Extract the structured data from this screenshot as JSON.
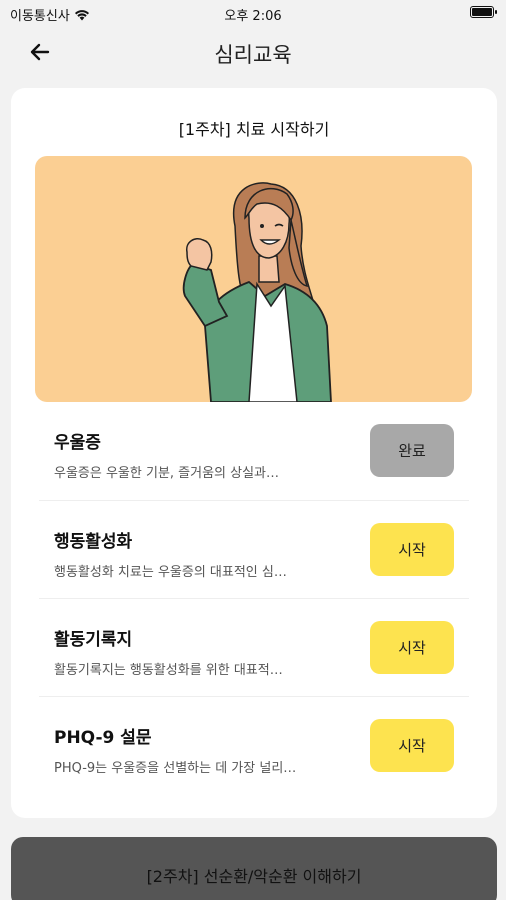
{
  "status_bar": {
    "carrier": "이동통신사",
    "time": "오후 2:06"
  },
  "nav": {
    "title": "심리교육"
  },
  "week": {
    "title": "[1주차] 치료 시작하기"
  },
  "lessons": [
    {
      "title": "우울증",
      "description": "우울증은 우울한 기분, 즐거움의 상실과…",
      "button": "완료",
      "status": "done"
    },
    {
      "title": "행동활성화",
      "description": "행동활성화 치료는 우울증의 대표적인 심…",
      "button": "시작",
      "status": "start"
    },
    {
      "title": "활동기록지",
      "description": "활동기록지는 행동활성화를 위한 대표적…",
      "button": "시작",
      "status": "start"
    },
    {
      "title": "PHQ-9 설문",
      "description": "PHQ-9는 우울증을 선별하는 데 가장 널리…",
      "button": "시작",
      "status": "start"
    }
  ],
  "next_week": {
    "title": "[2주차] 선순환/악순환 이해하기"
  },
  "colors": {
    "hero_background": "#fbcf93",
    "start_button": "#fde34f",
    "done_button": "#a8a8a8",
    "shirt": "#5e9e7a"
  }
}
